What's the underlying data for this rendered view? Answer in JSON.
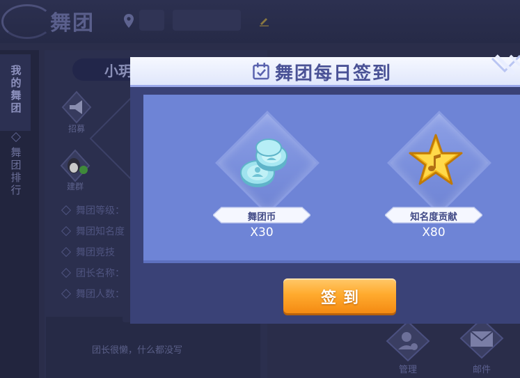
{
  "background": {
    "logo_title": "舞团",
    "name_partial": "小玥",
    "sidebar_tabs": [
      {
        "label": "我的舞团"
      },
      {
        "label": "舞团排行"
      }
    ],
    "buttons": [
      {
        "label": "招募"
      },
      {
        "label": "建群"
      }
    ],
    "info_rows": [
      {
        "label": "舞团等级："
      },
      {
        "label": "舞团知名度"
      },
      {
        "label": "舞团竞技"
      },
      {
        "label": "团长名称："
      },
      {
        "label": "舞团人数："
      }
    ],
    "description": "团长很懒，什么都没写",
    "bottom_buttons": [
      {
        "label": "管理"
      },
      {
        "label": "邮件"
      }
    ]
  },
  "modal": {
    "title": "舞团每日签到",
    "rewards": [
      {
        "name": "舞团币",
        "quantity": "X30",
        "icon": "coin-stack-icon"
      },
      {
        "name": "知名度贡献",
        "quantity": "X80",
        "icon": "star-note-icon"
      }
    ],
    "signin_label": "签到"
  },
  "colors": {
    "modal_body": "#3a4277",
    "reward_area": "#6e84d6",
    "header": "#eef2ff",
    "title_text": "#4a5296",
    "button_orange": "#ffab2e"
  }
}
